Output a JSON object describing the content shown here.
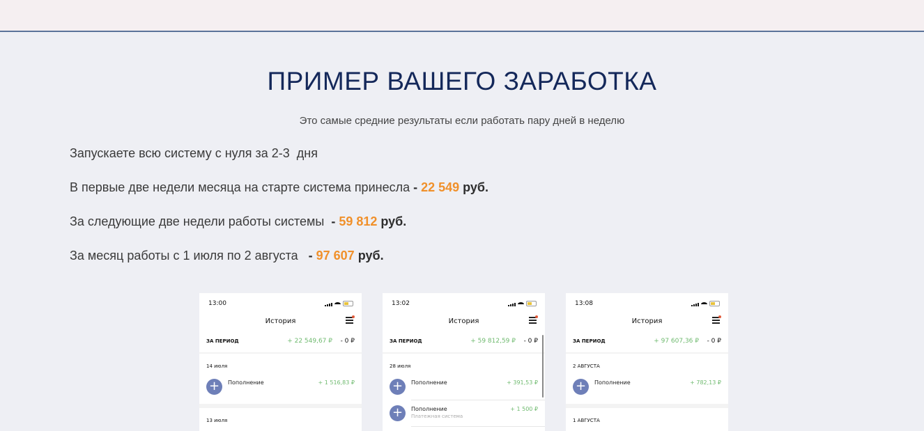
{
  "heading": {
    "title": "ПРИМЕР ВАШЕГО ЗАРАБОТКА",
    "subtitle": "Это самые средние результаты если работать пару дней в неделю"
  },
  "lines": [
    {
      "text": "Запускаете всю систему с нуля за 2-3  дня",
      "prefix": "",
      "amount": "",
      "currency": ""
    },
    {
      "text": "В первые две недели месяца на старте система принесла",
      "prefix": " - ",
      "amount": "22 549",
      "currency": " руб."
    },
    {
      "text": "За следующие две недели работы системы ",
      "prefix": " - ",
      "amount": "59 812",
      "currency": " руб."
    },
    {
      "text": "За месяц работы с 1 июля по 2 августа ",
      "prefix": "  - ",
      "amount": "97 607",
      "currency": " руб."
    }
  ],
  "phones": [
    {
      "time": "13:00",
      "nav_title": "История",
      "period_label": "ЗА ПЕРИОД",
      "period_in": "+ 22 549,67 ₽",
      "period_out": "- 0 ₽",
      "groups": [
        {
          "date": "14 июля",
          "ops": [
            {
              "label": "Пополнение",
              "sub": "",
              "amount": "+ 1 516,83 ₽"
            }
          ]
        },
        {
          "date": "13 июля",
          "ops": []
        }
      ]
    },
    {
      "time": "13:02",
      "nav_title": "История",
      "period_label": "ЗА ПЕРИОД",
      "period_in": "+ 59 812,59 ₽",
      "period_out": "- 0 ₽",
      "groups": [
        {
          "date": "28 июля",
          "ops": [
            {
              "label": "Пополнение",
              "sub": "",
              "amount": "+ 391,53 ₽"
            },
            {
              "label": "Пополнение",
              "sub": "Платежная система",
              "amount": "+ 1 500 ₽"
            }
          ]
        }
      ]
    },
    {
      "time": "13:08",
      "nav_title": "История",
      "period_label": "ЗА ПЕРИОД",
      "period_in": "+ 97 607,36 ₽",
      "period_out": "- 0 ₽",
      "groups": [
        {
          "date": "2 АВГУСТА",
          "ops": [
            {
              "label": "Пополнение",
              "sub": "",
              "amount": "+ 782,13 ₽"
            }
          ]
        },
        {
          "date": "1 АВГУСТА",
          "ops": []
        }
      ]
    }
  ],
  "icons": {
    "op": "plus-circle-icon",
    "filter": "filter-icon"
  },
  "colors": {
    "accent": "#f0902a",
    "title": "#14285a",
    "income": "#6fba6f",
    "op_icon": "#6e7fb8"
  }
}
